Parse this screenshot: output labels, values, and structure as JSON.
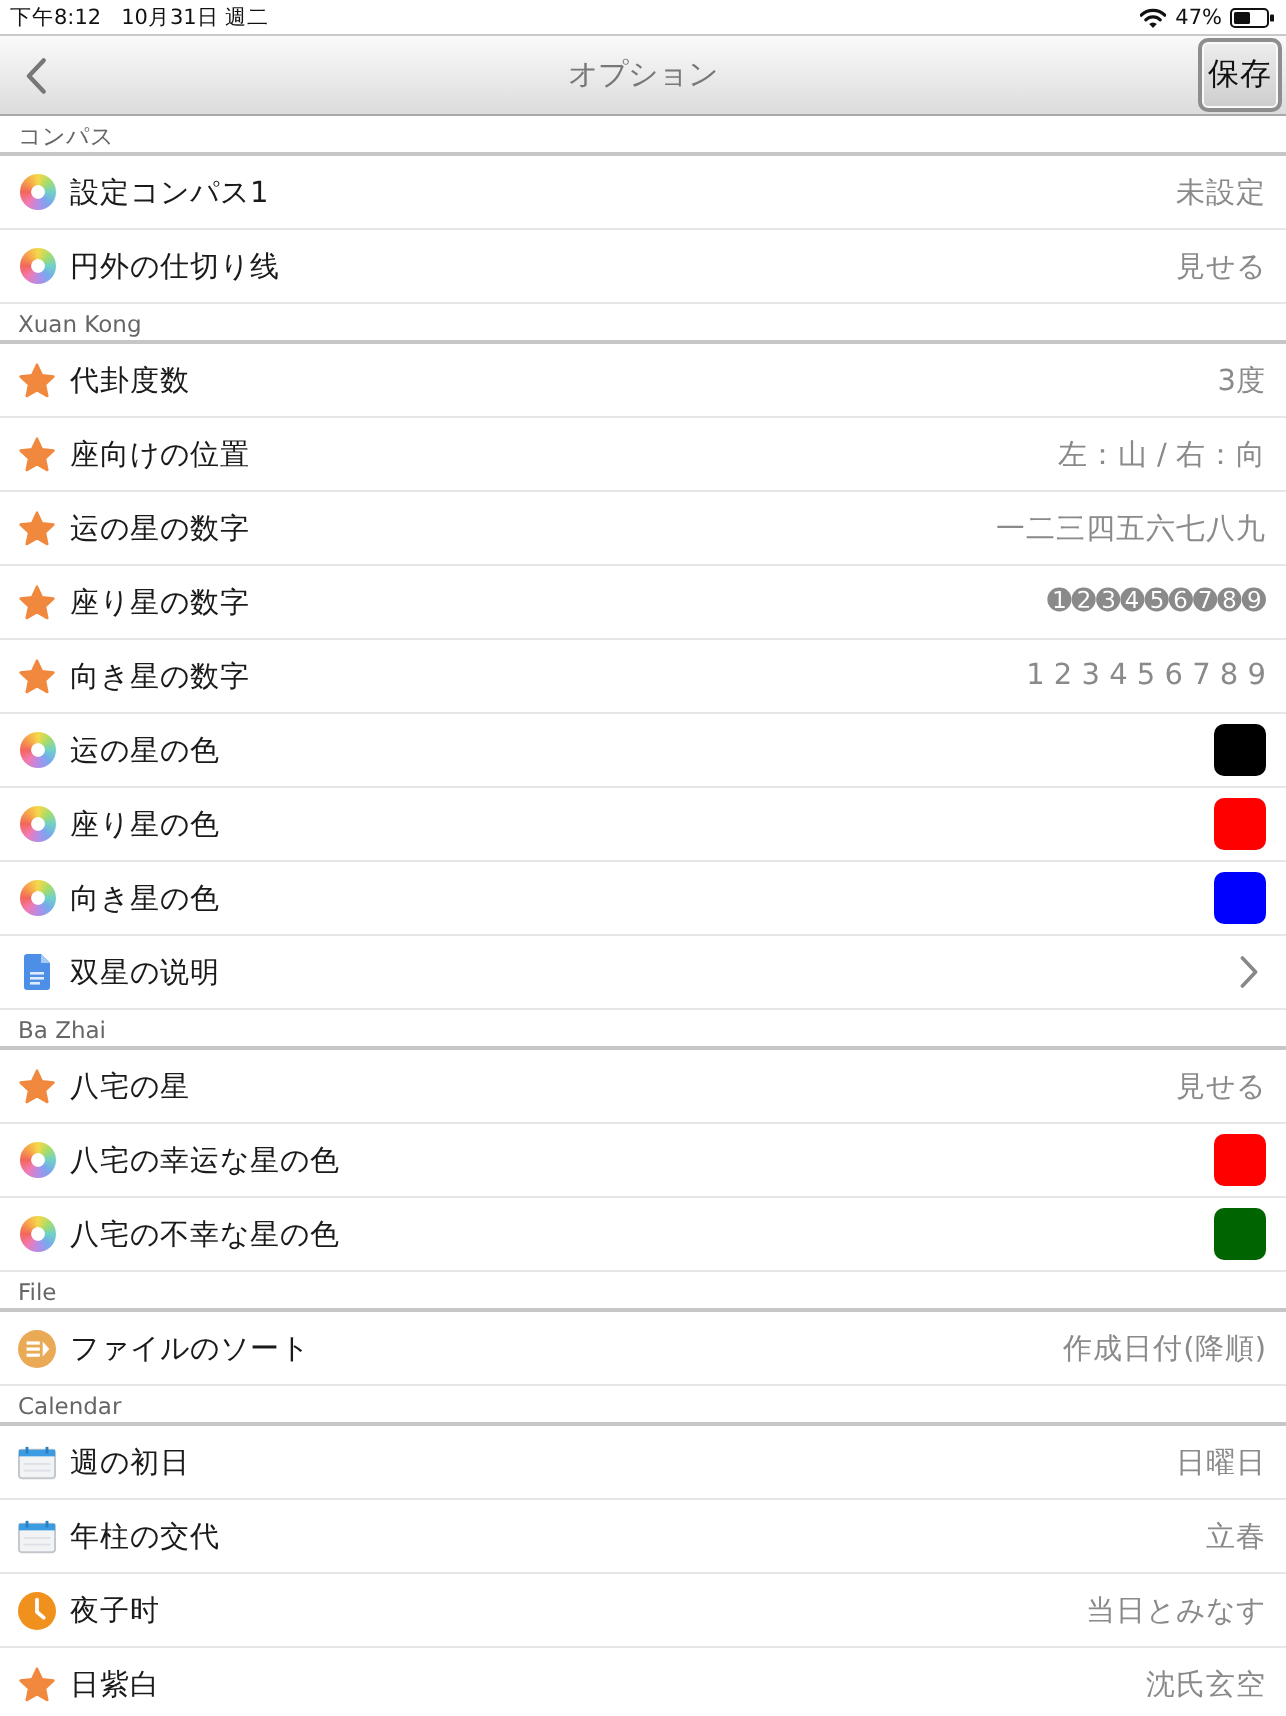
{
  "status_bar": {
    "time": "下午8:12",
    "date": "10月31日 週二",
    "battery": "47%"
  },
  "nav": {
    "title": "オプション",
    "save": "保存"
  },
  "sections": [
    {
      "title": "コンパス",
      "rows": [
        {
          "kind": "display",
          "label": "設定コンパス1",
          "value": "未設定"
        },
        {
          "kind": "display",
          "label": "円外の仕切り线",
          "value": "見せる"
        }
      ]
    },
    {
      "title": "Xuan Kong",
      "rows": [
        {
          "kind": "choice",
          "label": "代卦度数",
          "value": "3度"
        },
        {
          "kind": "choice",
          "label": "座向けの位置",
          "value": "左：山 / 右：向"
        },
        {
          "kind": "choice",
          "label": "运の星の数字",
          "value": "一二三四五六七八九"
        },
        {
          "kind": "choice",
          "label": "座り星の数字",
          "value": "➊➋➌➍➎➏➐➑➒"
        },
        {
          "kind": "choice",
          "label": "向き星の数字",
          "value": "1 2 3 4 5 6 7 8 9"
        },
        {
          "kind": "color",
          "label": "运の星の色",
          "color": "#000000"
        },
        {
          "kind": "color",
          "label": "座り星の色",
          "color": "#ff0000"
        },
        {
          "kind": "color",
          "label": "向き星の色",
          "color": "#0000ff"
        },
        {
          "kind": "link",
          "label": "双星の说明"
        }
      ]
    },
    {
      "title": "Ba Zhai",
      "rows": [
        {
          "kind": "choice",
          "label": "八宅の星",
          "value": "見せる"
        },
        {
          "kind": "color",
          "label": "八宅の幸运な星の色",
          "color": "#ff0000"
        },
        {
          "kind": "color",
          "label": "八宅の不幸な星の色",
          "color": "#006400"
        }
      ]
    },
    {
      "title": "File",
      "rows": [
        {
          "kind": "sort",
          "label": "ファイルのソート",
          "value": "作成日付(降順)"
        }
      ]
    },
    {
      "title": "Calendar",
      "rows": [
        {
          "kind": "date",
          "label": "週の初日",
          "value": "日曜日"
        },
        {
          "kind": "date",
          "label": "年柱の交代",
          "value": "立春"
        },
        {
          "kind": "time",
          "label": "夜子时",
          "value": "当日とみなす"
        },
        {
          "kind": "choice",
          "label": "日紫白",
          "value": "沈氏玄空"
        }
      ]
    }
  ]
}
